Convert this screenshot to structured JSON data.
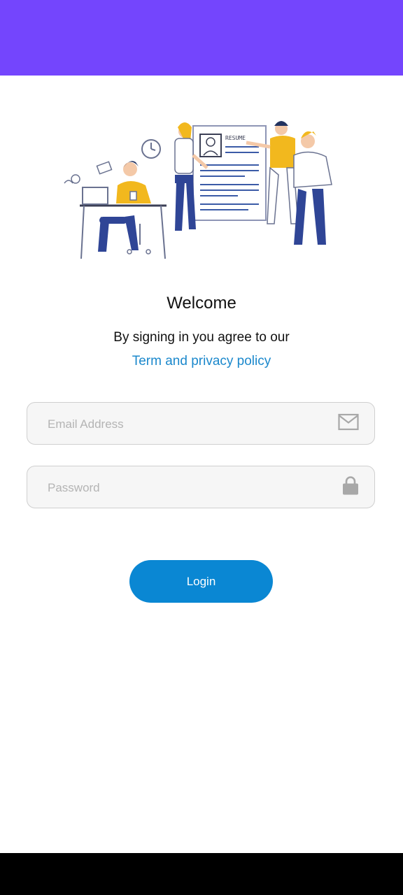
{
  "header": {
    "color": "#7445fd"
  },
  "illustration": {
    "name": "team-reviewing-resume-illustration",
    "badge_text": "RESUME"
  },
  "welcome": {
    "title": "Welcome",
    "agree_text": "By signing in you agree to our",
    "policy_link": "Term and privacy policy"
  },
  "form": {
    "email": {
      "placeholder": "Email Address",
      "value": "",
      "icon": "mail-icon"
    },
    "password": {
      "placeholder": "Password",
      "value": "",
      "icon": "lock-icon"
    },
    "login_label": "Login"
  },
  "colors": {
    "accent": "#0a87d3",
    "link": "#1b88cc",
    "brand": "#7445fd"
  }
}
